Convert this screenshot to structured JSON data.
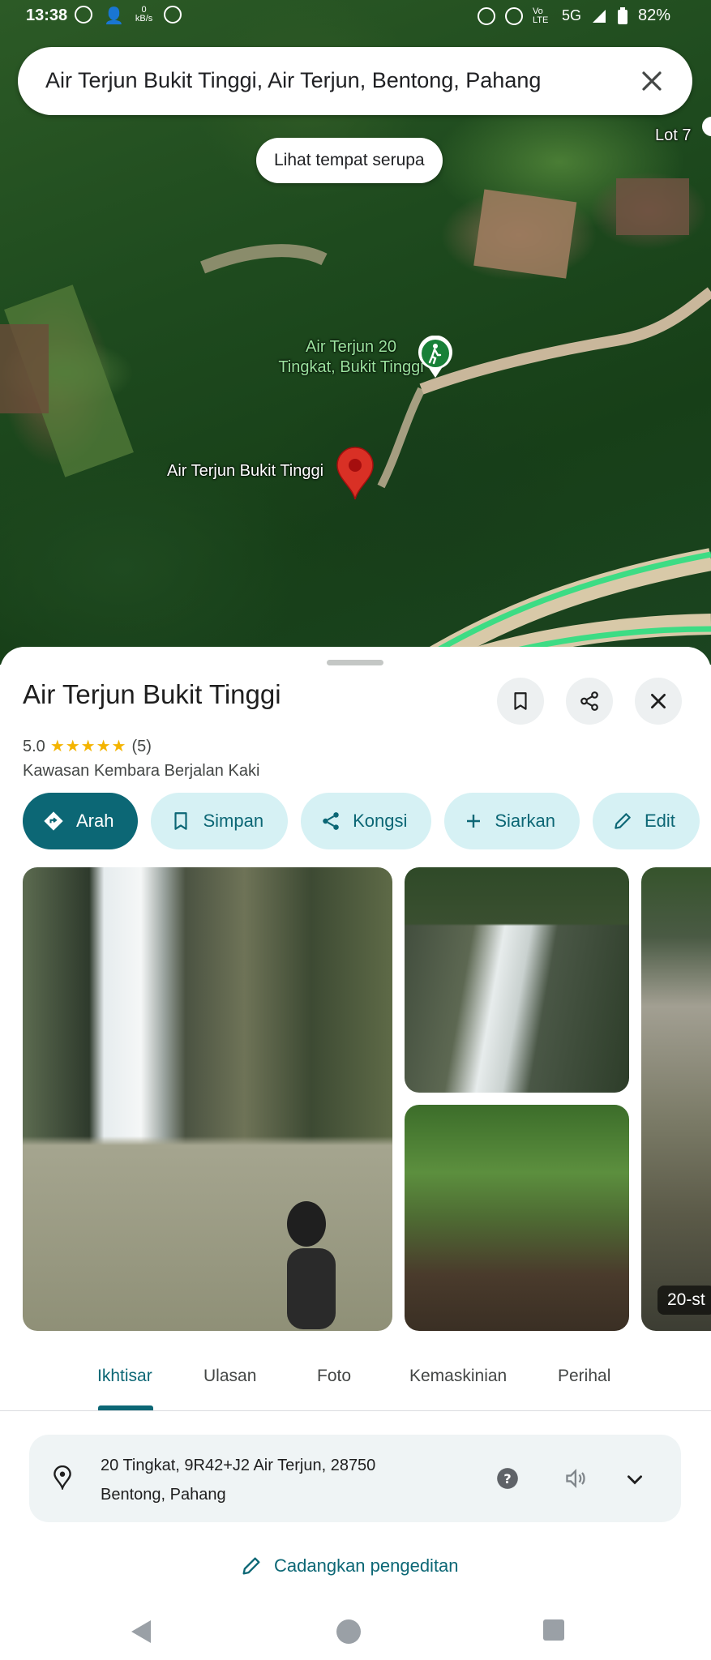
{
  "status": {
    "time": "13:38",
    "net_speed_value": "0",
    "net_speed_unit": "kB/s",
    "volte": "Vo LTE",
    "network": "5G",
    "battery": "82%"
  },
  "search": {
    "query": "Air Terjun Bukit Tinggi, Air Terjun, Bentong, Pahang"
  },
  "map": {
    "similar_button": "Lihat tempat serupa",
    "lot_label": "Lot 7",
    "poi_label_line1": "Air Terjun 20",
    "poi_label_line2": "Tingkat, Bukit Tinggi",
    "pin_label": "Air Terjun Bukit Tinggi"
  },
  "place": {
    "title": "Air Terjun Bukit Tinggi",
    "rating": "5.0",
    "stars": "★★★★★",
    "reviews": "(5)",
    "category": "Kawasan Kembara Berjalan Kaki"
  },
  "actions": [
    {
      "label": "Arah"
    },
    {
      "label": "Simpan"
    },
    {
      "label": "Kongsi"
    },
    {
      "label": "Siarkan"
    },
    {
      "label": "Edit"
    }
  ],
  "photos": {
    "badge": "20-st"
  },
  "tabs": [
    {
      "label": "Ikhtisar"
    },
    {
      "label": "Ulasan"
    },
    {
      "label": "Foto"
    },
    {
      "label": "Kemaskinian"
    },
    {
      "label": "Perihal"
    }
  ],
  "address": {
    "line1": "20 Tingkat, 9R42+J2 Air Terjun, 28750",
    "line2": "Bentong, Pahang"
  },
  "suggest_edit": "Cadangkan pengeditan",
  "colors": {
    "accent": "#0c6775",
    "chip_bg": "#d6f1f4",
    "pin": "#d93025",
    "route": "#3ddc84"
  }
}
